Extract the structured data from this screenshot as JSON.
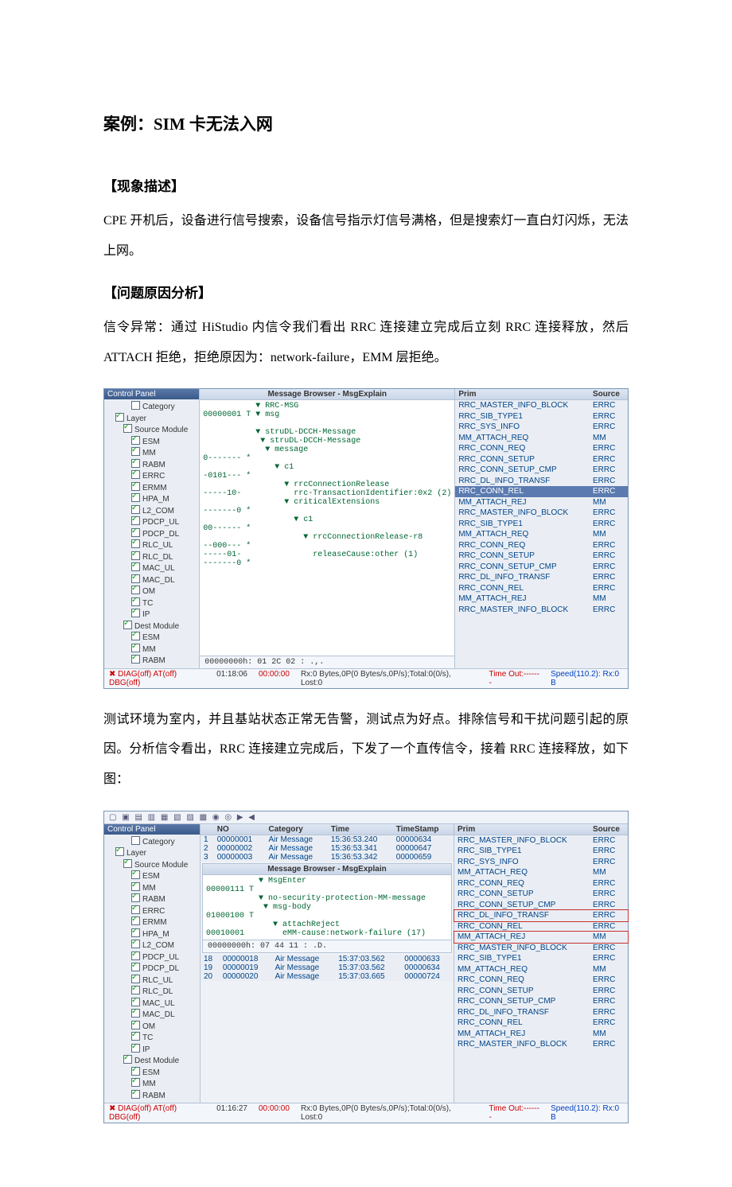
{
  "title": "案例：SIM 卡无法入网",
  "s1": {
    "hdr": "【现象描述】",
    "para": "CPE 开机后，设备进行信号搜索，设备信号指示灯信号满格，但是搜索灯一直白灯闪烁，无法上网。"
  },
  "s2": {
    "hdr": "【问题原因分析】",
    "para": "信令异常：通过 HiStudio 内信令我们看出 RRC 连接建立完成后立刻 RRC 连接释放，然后 ATTACH 拒绝，拒绝原因为：network-failure，EMM 层拒绝。"
  },
  "s3": {
    "para": "测试环境为室内，并且基站状态正常无告警，测试点为好点。排除信号和干扰问题引起的原因。分析信令看出，RRC 连接建立完成后，下发了一个直传信令，接着 RRC 连接释放，如下图："
  },
  "panel1": {
    "cpTitle": "Control Panel",
    "tree": [
      "Category",
      "Layer",
      "Source Module",
      "ESM",
      "MM",
      "RABM",
      "ERRC",
      "ERMM",
      "HPA_M",
      "L2_COM",
      "PDCP_UL",
      "PDCP_DL",
      "RLC_UL",
      "RLC_DL",
      "MAC_UL",
      "MAC_DL",
      "OM",
      "TC",
      "IP",
      "Dest Module",
      "ESM",
      "MM",
      "RABM"
    ],
    "msgTitle": "Message Browser - MsgExplain",
    "msgBody": "           ▼ RRC-MSG\n00000001 T ▼ msg\n\n           ▼ struDL-DCCH-Message\n            ▼ struDL-DCCH-Message\n             ▼ message\n0------- *\n               ▼ c1\n-0101--- *\n                 ▼ rrcConnectionRelease\n-----10-           rrc-TransactionIdentifier:0x2 (2)\n                 ▼ criticalExtensions\n-------0 *\n                   ▼ c1\n00------ *\n                     ▼ rrcConnectionRelease-r8\n--000--- *\n-----01-               releaseCause:other (1)\n-------0 *",
    "hex": "00000000h: 01 2C 02                          : .,.",
    "primHdr": "Prim",
    "srcHdr": "Source",
    "rows": [
      [
        "RRC_MASTER_INFO_BLOCK",
        "ERRC",
        ""
      ],
      [
        "RRC_SIB_TYPE1",
        "ERRC",
        ""
      ],
      [
        "RRC_SYS_INFO",
        "ERRC",
        ""
      ],
      [
        "MM_ATTACH_REQ",
        "MM",
        ""
      ],
      [
        "RRC_CONN_REQ",
        "ERRC",
        ""
      ],
      [
        "RRC_CONN_SETUP",
        "ERRC",
        ""
      ],
      [
        "RRC_CONN_SETUP_CMP",
        "ERRC",
        ""
      ],
      [
        "RRC_DL_INFO_TRANSF",
        "ERRC",
        ""
      ],
      [
        "RRC_CONN_REL",
        "ERRC",
        "hl"
      ],
      [
        "MM_ATTACH_REJ",
        "MM",
        ""
      ],
      [
        "RRC_MASTER_INFO_BLOCK",
        "ERRC",
        ""
      ],
      [
        "RRC_SIB_TYPE1",
        "ERRC",
        ""
      ],
      [
        "MM_ATTACH_REQ",
        "MM",
        ""
      ],
      [
        "RRC_CONN_REQ",
        "ERRC",
        ""
      ],
      [
        "RRC_CONN_SETUP",
        "ERRC",
        ""
      ],
      [
        "RRC_CONN_SETUP_CMP",
        "ERRC",
        ""
      ],
      [
        "RRC_DL_INFO_TRANSF",
        "ERRC",
        ""
      ],
      [
        "RRC_CONN_REL",
        "ERRC",
        ""
      ],
      [
        "MM_ATTACH_REJ",
        "MM",
        ""
      ],
      [
        "RRC_MASTER_INFO_BLOCK",
        "ERRC",
        ""
      ]
    ],
    "status": {
      "diag": "DIAG(off) AT(off) DBG(off)",
      "t": "01:18:06",
      "r": "00:00:00",
      "rx": "Rx:0 Bytes,0P(0 Bytes/s,0P/s);Total:0(0/s), Lost:0",
      "to": "Time Out:-------",
      "spd": "Speed(110.2): Rx:0 B"
    }
  },
  "panel2": {
    "cpTitle": "Control Panel",
    "tree": [
      "Category",
      "Layer",
      "Source Module",
      "ESM",
      "MM",
      "RABM",
      "ERRC",
      "ERMM",
      "HPA_M",
      "L2_COM",
      "PDCP_UL",
      "PDCP_DL",
      "RLC_UL",
      "RLC_DL",
      "MAC_UL",
      "MAC_DL",
      "OM",
      "TC",
      "IP",
      "Dest Module",
      "ESM",
      "MM",
      "RABM"
    ],
    "topHdr": [
      "NO",
      "Category",
      "Time",
      "TimeStamp"
    ],
    "topRows": [
      [
        "1",
        "00000001",
        "Air Message",
        "15:36:53.240",
        "00000634"
      ],
      [
        "2",
        "00000002",
        "Air Message",
        "15:36:53.341",
        "00000647"
      ],
      [
        "3",
        "00000003",
        "Air Message",
        "15:36:53.342",
        "00000659"
      ]
    ],
    "msgTitle": "Message Browser - MsgExplain",
    "msgBody": "           ▼ MsgEnter\n00000111 T\n           ▼ no-security-protection-MM-message\n            ▼ msg-body\n01000100 T\n              ▼ attachReject\n00010001        eMM-cause:network-failure (17)",
    "hex": "00000000h: 07 44 11                          : .D.",
    "botRows": [
      [
        "18",
        "00000018",
        "Air Message",
        "15:37:03.562",
        "00000633"
      ],
      [
        "19",
        "00000019",
        "Air Message",
        "15:37:03.562",
        "00000634"
      ],
      [
        "20",
        "00000020",
        "Air Message",
        "15:37:03.665",
        "00000724"
      ]
    ],
    "primHdr": "Prim",
    "srcHdr": "Source",
    "rows": [
      [
        "RRC_MASTER_INFO_BLOCK",
        "ERRC",
        ""
      ],
      [
        "RRC_SIB_TYPE1",
        "ERRC",
        ""
      ],
      [
        "RRC_SYS_INFO",
        "ERRC",
        ""
      ],
      [
        "MM_ATTACH_REQ",
        "MM",
        ""
      ],
      [
        "RRC_CONN_REQ",
        "ERRC",
        ""
      ],
      [
        "RRC_CONN_SETUP",
        "ERRC",
        ""
      ],
      [
        "RRC_CONN_SETUP_CMP",
        "ERRC",
        ""
      ],
      [
        "RRC_DL_INFO_TRANSF",
        "ERRC",
        "box"
      ],
      [
        "RRC_CONN_REL",
        "ERRC",
        ""
      ],
      [
        "MM_ATTACH_REJ",
        "MM",
        "box"
      ],
      [
        "RRC_MASTER_INFO_BLOCK",
        "ERRC",
        ""
      ],
      [
        "RRC_SIB_TYPE1",
        "ERRC",
        ""
      ],
      [
        "MM_ATTACH_REQ",
        "MM",
        ""
      ],
      [
        "RRC_CONN_REQ",
        "ERRC",
        ""
      ],
      [
        "RRC_CONN_SETUP",
        "ERRC",
        ""
      ],
      [
        "RRC_CONN_SETUP_CMP",
        "ERRC",
        ""
      ],
      [
        "RRC_DL_INFO_TRANSF",
        "ERRC",
        ""
      ],
      [
        "RRC_CONN_REL",
        "ERRC",
        ""
      ],
      [
        "MM_ATTACH_REJ",
        "MM",
        ""
      ],
      [
        "RRC_MASTER_INFO_BLOCK",
        "ERRC",
        ""
      ]
    ],
    "status": {
      "diag": "DIAG(off) AT(off) DBG(off)",
      "t": "01:16:27",
      "r": "00:00:00",
      "rx": "Rx:0 Bytes,0P(0 Bytes/s,0P/s);Total:0(0/s), Lost:0",
      "to": "Time Out:-------",
      "spd": "Speed(110.2): Rx:0 B"
    }
  }
}
